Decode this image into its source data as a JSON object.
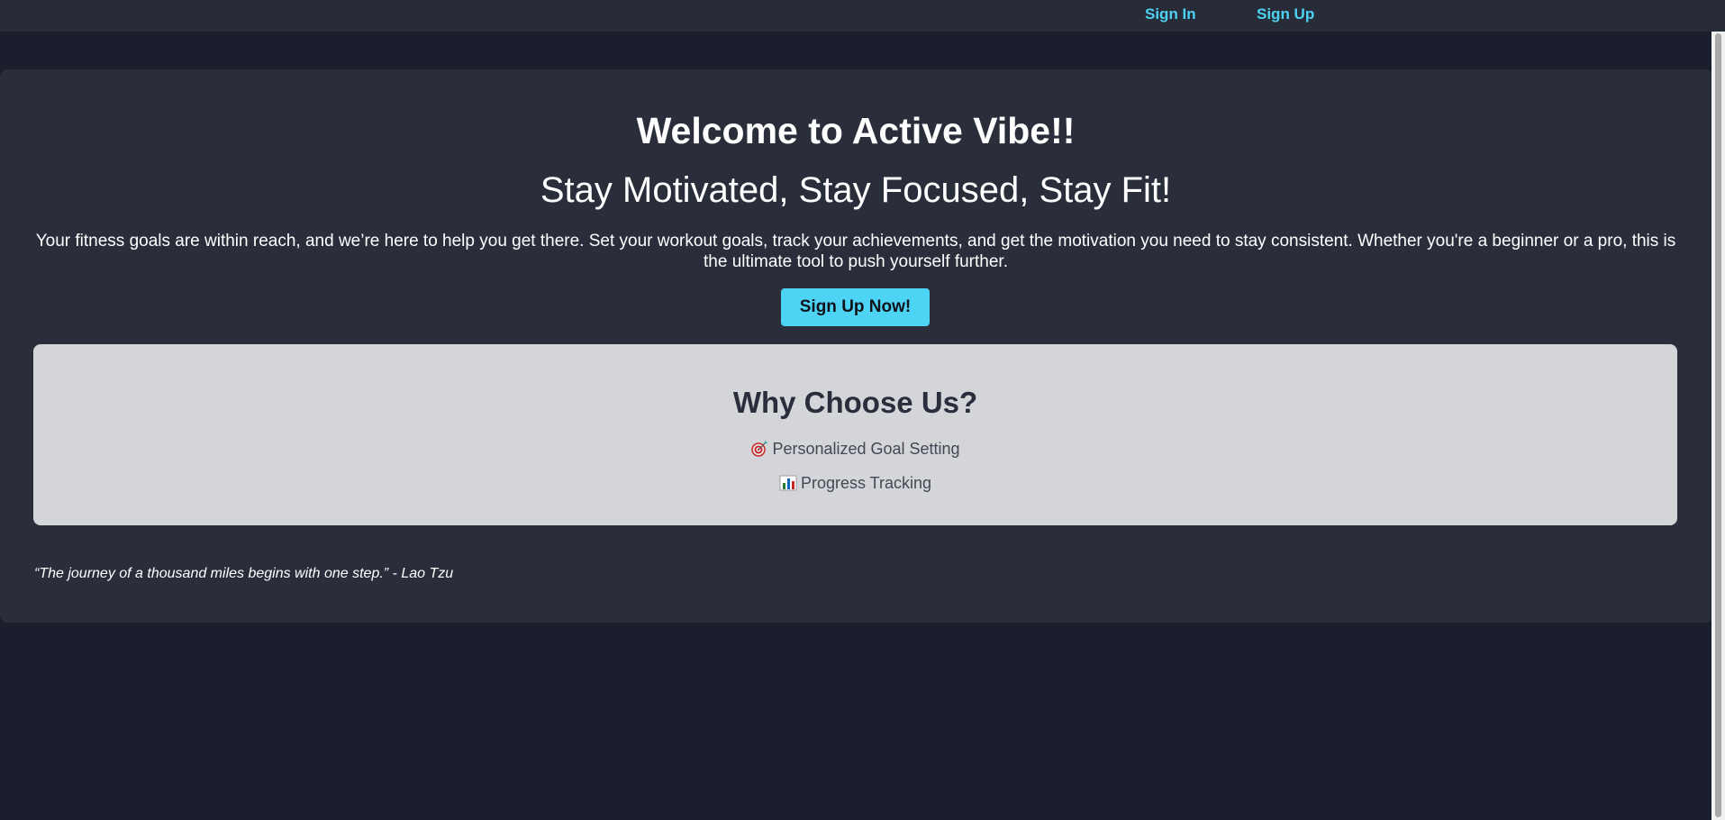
{
  "nav": {
    "signin_label": "Sign In",
    "signup_label": "Sign Up",
    "link_color": "#4dd2f2"
  },
  "hero": {
    "title": "Welcome to Active Vibe!!",
    "subtitle": "Stay Motivated, Stay Focused, Stay Fit!",
    "text": "Your fitness goals are within reach, and we’re here to help you get there. Set your workout goals, track your achievements, and get the motivation you need to stay consistent. Whether you're a beginner or a pro, this is the ultimate tool to push yourself further.",
    "cta_label": "Sign Up Now!",
    "cta_color": "#4dd4f5"
  },
  "features": {
    "title": "Why Choose Us?",
    "items": [
      {
        "icon": "target-icon",
        "label": "Personalized Goal Setting"
      },
      {
        "icon": "bar-chart-icon",
        "label": "Progress Tracking"
      }
    ]
  },
  "quote": {
    "text": "“The journey of a thousand miles begins with one step.” - Lao Tzu"
  },
  "colors": {
    "page_bg": "#1b1e2c",
    "card_bg": "#2a2e3b",
    "features_bg": "#d4d5d9"
  }
}
